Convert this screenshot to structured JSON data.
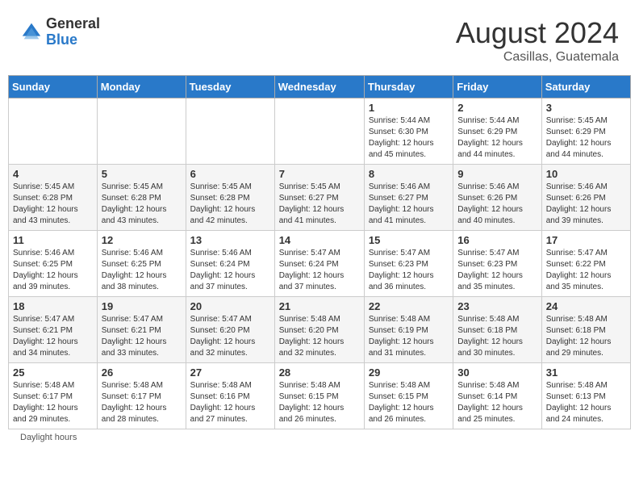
{
  "header": {
    "logo_general": "General",
    "logo_blue": "Blue",
    "month_title": "August 2024",
    "location": "Casillas, Guatemala"
  },
  "days_of_week": [
    "Sunday",
    "Monday",
    "Tuesday",
    "Wednesday",
    "Thursday",
    "Friday",
    "Saturday"
  ],
  "weeks": [
    [
      {
        "day": "",
        "info": ""
      },
      {
        "day": "",
        "info": ""
      },
      {
        "day": "",
        "info": ""
      },
      {
        "day": "",
        "info": ""
      },
      {
        "day": "1",
        "info": "Sunrise: 5:44 AM\nSunset: 6:30 PM\nDaylight: 12 hours\nand 45 minutes."
      },
      {
        "day": "2",
        "info": "Sunrise: 5:44 AM\nSunset: 6:29 PM\nDaylight: 12 hours\nand 44 minutes."
      },
      {
        "day": "3",
        "info": "Sunrise: 5:45 AM\nSunset: 6:29 PM\nDaylight: 12 hours\nand 44 minutes."
      }
    ],
    [
      {
        "day": "4",
        "info": "Sunrise: 5:45 AM\nSunset: 6:28 PM\nDaylight: 12 hours\nand 43 minutes."
      },
      {
        "day": "5",
        "info": "Sunrise: 5:45 AM\nSunset: 6:28 PM\nDaylight: 12 hours\nand 43 minutes."
      },
      {
        "day": "6",
        "info": "Sunrise: 5:45 AM\nSunset: 6:28 PM\nDaylight: 12 hours\nand 42 minutes."
      },
      {
        "day": "7",
        "info": "Sunrise: 5:45 AM\nSunset: 6:27 PM\nDaylight: 12 hours\nand 41 minutes."
      },
      {
        "day": "8",
        "info": "Sunrise: 5:46 AM\nSunset: 6:27 PM\nDaylight: 12 hours\nand 41 minutes."
      },
      {
        "day": "9",
        "info": "Sunrise: 5:46 AM\nSunset: 6:26 PM\nDaylight: 12 hours\nand 40 minutes."
      },
      {
        "day": "10",
        "info": "Sunrise: 5:46 AM\nSunset: 6:26 PM\nDaylight: 12 hours\nand 39 minutes."
      }
    ],
    [
      {
        "day": "11",
        "info": "Sunrise: 5:46 AM\nSunset: 6:25 PM\nDaylight: 12 hours\nand 39 minutes."
      },
      {
        "day": "12",
        "info": "Sunrise: 5:46 AM\nSunset: 6:25 PM\nDaylight: 12 hours\nand 38 minutes."
      },
      {
        "day": "13",
        "info": "Sunrise: 5:46 AM\nSunset: 6:24 PM\nDaylight: 12 hours\nand 37 minutes."
      },
      {
        "day": "14",
        "info": "Sunrise: 5:47 AM\nSunset: 6:24 PM\nDaylight: 12 hours\nand 37 minutes."
      },
      {
        "day": "15",
        "info": "Sunrise: 5:47 AM\nSunset: 6:23 PM\nDaylight: 12 hours\nand 36 minutes."
      },
      {
        "day": "16",
        "info": "Sunrise: 5:47 AM\nSunset: 6:23 PM\nDaylight: 12 hours\nand 35 minutes."
      },
      {
        "day": "17",
        "info": "Sunrise: 5:47 AM\nSunset: 6:22 PM\nDaylight: 12 hours\nand 35 minutes."
      }
    ],
    [
      {
        "day": "18",
        "info": "Sunrise: 5:47 AM\nSunset: 6:21 PM\nDaylight: 12 hours\nand 34 minutes."
      },
      {
        "day": "19",
        "info": "Sunrise: 5:47 AM\nSunset: 6:21 PM\nDaylight: 12 hours\nand 33 minutes."
      },
      {
        "day": "20",
        "info": "Sunrise: 5:47 AM\nSunset: 6:20 PM\nDaylight: 12 hours\nand 32 minutes."
      },
      {
        "day": "21",
        "info": "Sunrise: 5:48 AM\nSunset: 6:20 PM\nDaylight: 12 hours\nand 32 minutes."
      },
      {
        "day": "22",
        "info": "Sunrise: 5:48 AM\nSunset: 6:19 PM\nDaylight: 12 hours\nand 31 minutes."
      },
      {
        "day": "23",
        "info": "Sunrise: 5:48 AM\nSunset: 6:18 PM\nDaylight: 12 hours\nand 30 minutes."
      },
      {
        "day": "24",
        "info": "Sunrise: 5:48 AM\nSunset: 6:18 PM\nDaylight: 12 hours\nand 29 minutes."
      }
    ],
    [
      {
        "day": "25",
        "info": "Sunrise: 5:48 AM\nSunset: 6:17 PM\nDaylight: 12 hours\nand 29 minutes."
      },
      {
        "day": "26",
        "info": "Sunrise: 5:48 AM\nSunset: 6:17 PM\nDaylight: 12 hours\nand 28 minutes."
      },
      {
        "day": "27",
        "info": "Sunrise: 5:48 AM\nSunset: 6:16 PM\nDaylight: 12 hours\nand 27 minutes."
      },
      {
        "day": "28",
        "info": "Sunrise: 5:48 AM\nSunset: 6:15 PM\nDaylight: 12 hours\nand 26 minutes."
      },
      {
        "day": "29",
        "info": "Sunrise: 5:48 AM\nSunset: 6:15 PM\nDaylight: 12 hours\nand 26 minutes."
      },
      {
        "day": "30",
        "info": "Sunrise: 5:48 AM\nSunset: 6:14 PM\nDaylight: 12 hours\nand 25 minutes."
      },
      {
        "day": "31",
        "info": "Sunrise: 5:48 AM\nSunset: 6:13 PM\nDaylight: 12 hours\nand 24 minutes."
      }
    ]
  ],
  "footer": {
    "daylight_label": "Daylight hours"
  }
}
